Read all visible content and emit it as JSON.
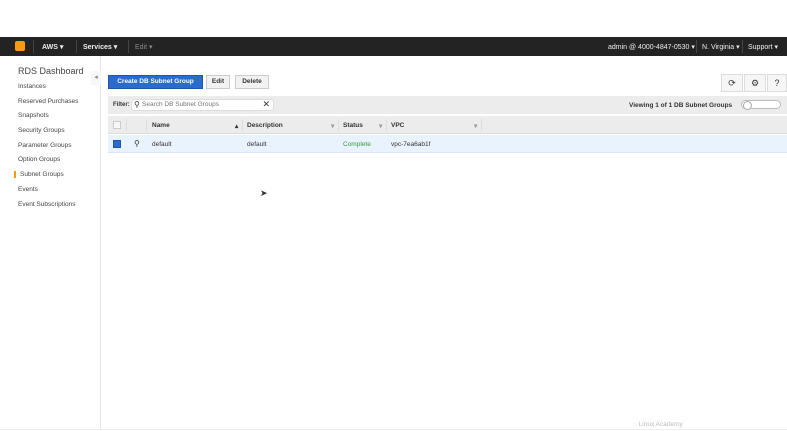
{
  "topbar": {
    "brand": "AWS",
    "services": "Services",
    "edit": "Edit",
    "account": "admin @ 4000-4847-0530",
    "region": "N. Virginia",
    "support": "Support"
  },
  "sidebar": {
    "title": "RDS Dashboard",
    "items": [
      "Instances",
      "Reserved Purchases",
      "Snapshots",
      "Security Groups",
      "Parameter Groups",
      "Option Groups",
      "Subnet Groups",
      "Events",
      "Event Subscriptions"
    ],
    "active": "Subnet Groups"
  },
  "toolbar": {
    "create": "Create DB Subnet Group",
    "edit": "Edit",
    "delete": "Delete"
  },
  "filter": {
    "label": "Filter:",
    "placeholder": "Search DB Subnet Groups",
    "viewing": "Viewing 1 of 1 DB Subnet Groups"
  },
  "table": {
    "columns": [
      "Name",
      "Description",
      "Status",
      "VPC"
    ],
    "rows": [
      {
        "name": "default",
        "description": "default",
        "status": "Complete",
        "vpc": "vpc-7ea6ab1f"
      }
    ]
  },
  "watermark": "Linux Academy",
  "colors": {
    "accent": "#2a6bcc",
    "status_complete": "#3c9a3c",
    "active_marker": "#f39c12"
  }
}
